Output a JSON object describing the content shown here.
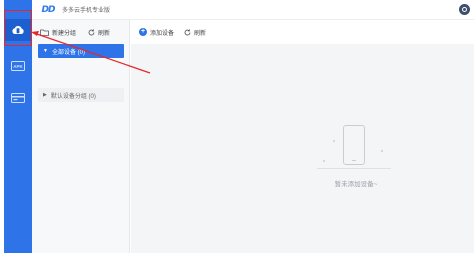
{
  "app": {
    "logo_text": "DD",
    "title": "多多云手机专业版"
  },
  "rail": {
    "apk_label": "APK"
  },
  "panel": {
    "new_group_label": "新建分组",
    "refresh_label": "刷新",
    "groups": [
      {
        "label": "全部设备 (0)",
        "active": true
      },
      {
        "label": "默认设备分组 (0)",
        "active": false
      }
    ]
  },
  "main": {
    "add_device_label": "添加设备",
    "refresh_label": "刷新",
    "empty_text": "暂未添加设备~"
  },
  "colors": {
    "accent": "#2e74e8",
    "annotation": "#e8262a"
  }
}
